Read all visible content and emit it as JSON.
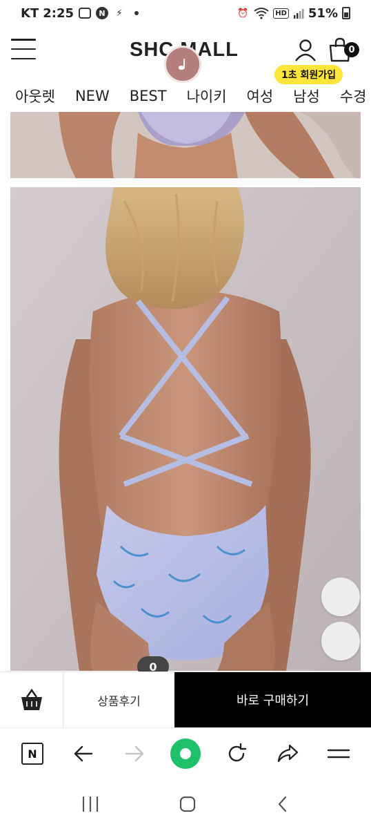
{
  "status_bar": {
    "carrier": "KT",
    "time": "2:25",
    "network_badge": "HD",
    "battery": "51%"
  },
  "header": {
    "logo": "SHC MALL",
    "cart_count": "0",
    "signup_badge": "1초 회원가입"
  },
  "categories": [
    "아웃렛",
    "NEW",
    "BEST",
    "나이키",
    "여성",
    "남성",
    "수경"
  ],
  "product": {
    "review_count": "0"
  },
  "buy_bar": {
    "review_label": "상품후기",
    "buy_label": "바로 구매하기"
  },
  "browser_toolbar": {
    "naver_label": "N"
  },
  "colors": {
    "accent_yellow": "#ffe53b",
    "naver_green": "#1ec06a",
    "buy_button": "#000000"
  }
}
